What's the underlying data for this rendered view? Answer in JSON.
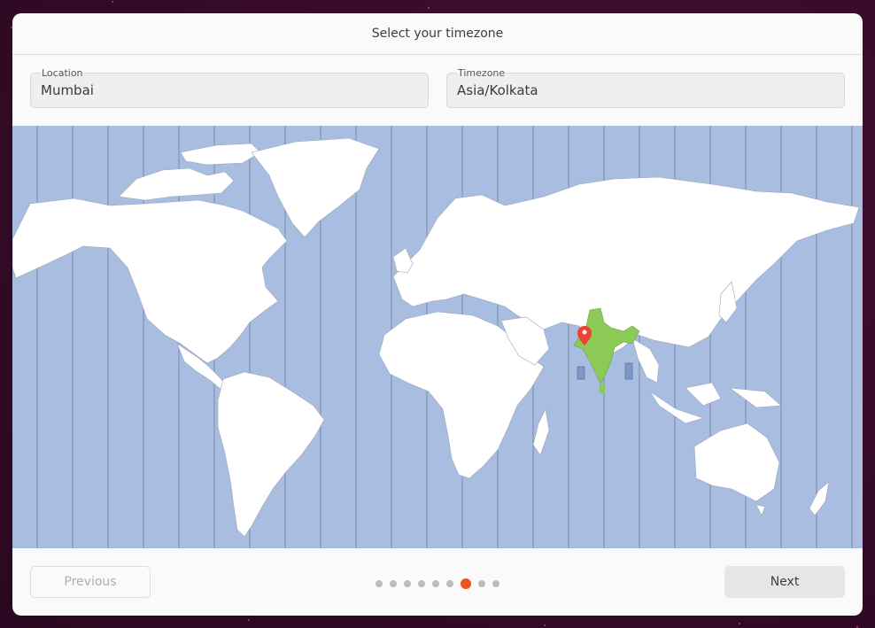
{
  "window": {
    "title": "Select your timezone"
  },
  "fields": {
    "location": {
      "label": "Location",
      "value": "Mumbai"
    },
    "timezone": {
      "label": "Timezone",
      "value": "Asia/Kolkata"
    }
  },
  "map": {
    "selected_region": "India",
    "pin_city": "Mumbai",
    "colors": {
      "ocean": "#a8bde0",
      "land": "#ffffff",
      "selected": "#8bcb55",
      "pin": "#ef4136",
      "zone_line": "#7a8aa8"
    }
  },
  "footer": {
    "previous_label": "Previous",
    "next_label": "Next",
    "pages_total": 9,
    "current_page": 7,
    "accent": "#e95420"
  }
}
